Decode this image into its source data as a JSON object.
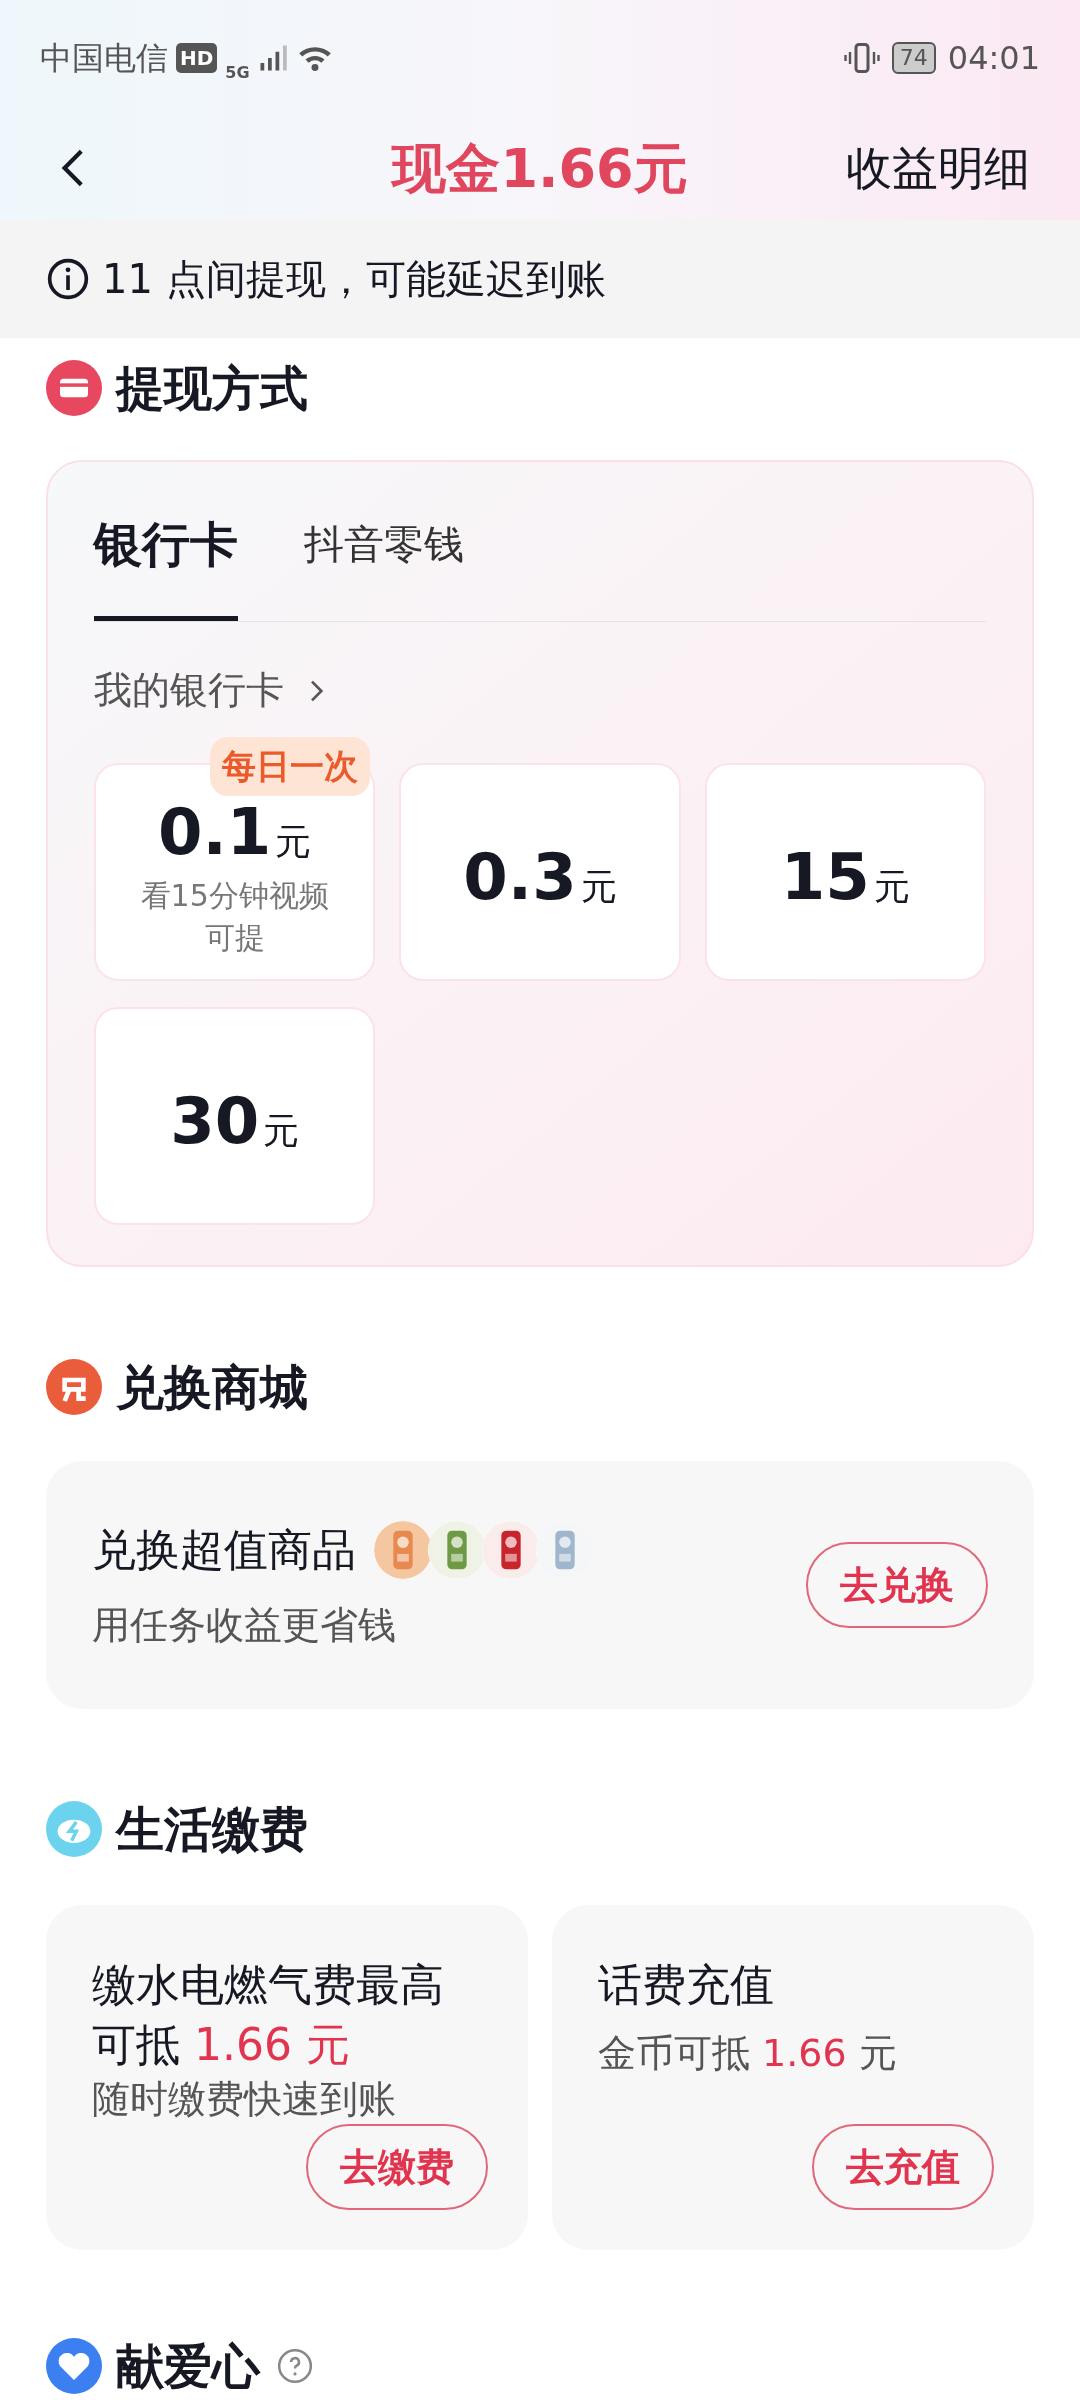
{
  "status_bar": {
    "carrier": "中国电信",
    "hd": "HD",
    "network": "5G",
    "battery": "74",
    "time": "04:01"
  },
  "header": {
    "title": "现金1.66元",
    "action": "收益明细"
  },
  "notice": {
    "text": "11 点间提现，可能延迟到账"
  },
  "withdraw": {
    "title": "提现方式",
    "tabs": [
      {
        "label": "银行卡",
        "selected": true
      },
      {
        "label": "抖音零钱",
        "selected": false
      }
    ],
    "link": "我的银行卡",
    "options": [
      {
        "amount": "0.1",
        "unit": "元",
        "badge": "每日一次",
        "note": "看15分钟视频可提"
      },
      {
        "amount": "0.3",
        "unit": "元"
      },
      {
        "amount": "15",
        "unit": "元"
      },
      {
        "amount": "30",
        "unit": "元"
      }
    ]
  },
  "mall": {
    "title": "兑换商城",
    "card": {
      "title": "兑换超值商品",
      "subtitle": "用任务收益更省钱",
      "button": "去兑换"
    }
  },
  "bills": {
    "title": "生活缴费",
    "cards": [
      {
        "title": "缴水电燃气费最高可抵",
        "highlight": "1.66 元",
        "subtitle": "随时缴费快速到账",
        "button": "去缴费"
      },
      {
        "title": "话费充值",
        "prefix": "金币可抵",
        "highlight": "1.66",
        "suffix": "元",
        "button": "去充值"
      }
    ]
  },
  "charity": {
    "title": "献爱心"
  }
}
